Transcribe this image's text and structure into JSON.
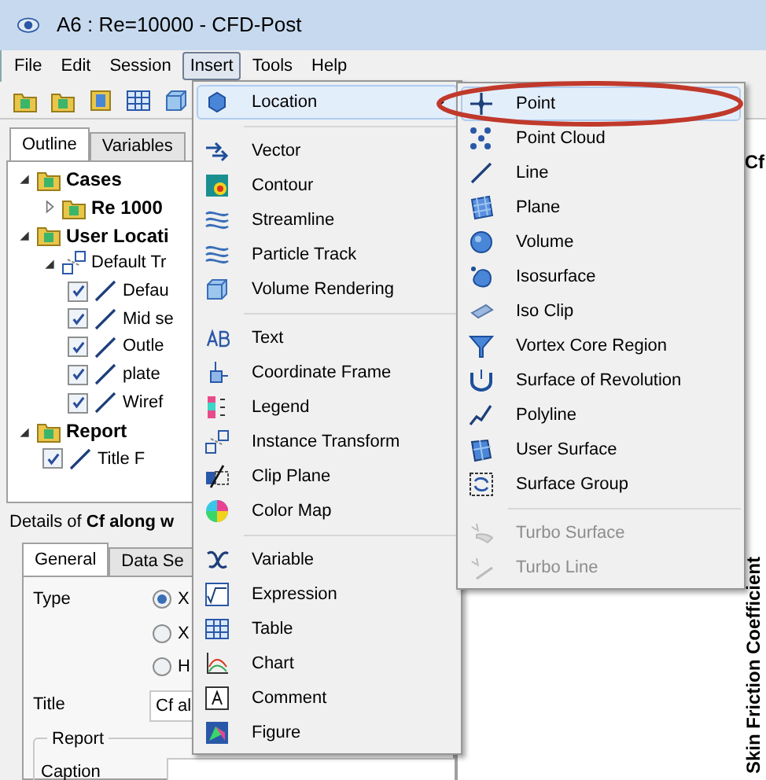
{
  "window": {
    "title": "A6 : Re=10000 - CFD-Post"
  },
  "menubar": [
    {
      "label": "File",
      "selected": false
    },
    {
      "label": "Edit",
      "selected": false
    },
    {
      "label": "Session",
      "selected": false
    },
    {
      "label": "Insert",
      "selected": true
    },
    {
      "label": "Tools",
      "selected": false
    },
    {
      "label": "Help",
      "selected": false
    }
  ],
  "outline": {
    "tabs": [
      {
        "label": "Outline",
        "selected": true
      },
      {
        "label": "Variables",
        "selected": false
      }
    ],
    "tree": [
      {
        "label": "Cases",
        "kind": "group",
        "expanded": true,
        "children": [
          {
            "label": "Re 1000",
            "kind": "group",
            "expanded": false
          }
        ]
      },
      {
        "label": "User Locati",
        "kind": "group",
        "expanded": true,
        "children": [
          {
            "label": "Default Tr",
            "kind": "folder",
            "expanded": true,
            "children": [
              {
                "label": "Defau",
                "kind": "item",
                "checked": true
              },
              {
                "label": "Mid se",
                "kind": "item",
                "checked": true
              },
              {
                "label": "Outle",
                "kind": "item",
                "checked": true
              },
              {
                "label": "plate",
                "kind": "item",
                "checked": true
              },
              {
                "label": "Wiref",
                "kind": "item",
                "checked": true
              }
            ]
          }
        ]
      },
      {
        "label": "Report",
        "kind": "group",
        "expanded": true,
        "children": [
          {
            "label": "Title F",
            "kind": "item",
            "checked": true
          }
        ]
      }
    ]
  },
  "details": {
    "title": "Details of **Cf along w**",
    "tabs": [
      {
        "label": "General",
        "selected": true
      },
      {
        "label": "Data Se",
        "selected": false
      }
    ],
    "type_label": "Type",
    "type_options": [
      {
        "label": "X",
        "selected": true
      },
      {
        "label": "X",
        "selected": false
      },
      {
        "label": "H",
        "selected": false
      }
    ],
    "title_label": "Title",
    "title_value": "Cf al",
    "group_label": "Report",
    "caption_label": "Caption"
  },
  "viewer": {
    "heading": "Cf",
    "axis_label": "Skin Friction Coefficient"
  },
  "insert_menu": {
    "groups": [
      [
        {
          "label": "Location",
          "submenu": true,
          "selected": true
        }
      ],
      [
        {
          "label": "Vector",
          "submenu": false,
          "selected": false
        },
        {
          "label": "Contour",
          "submenu": false,
          "selected": false
        },
        {
          "label": "Streamline",
          "submenu": false,
          "selected": false
        },
        {
          "label": "Particle Track",
          "submenu": false,
          "selected": false
        },
        {
          "label": "Volume Rendering",
          "submenu": false,
          "selected": false
        }
      ],
      [
        {
          "label": "Text",
          "submenu": false,
          "selected": false
        },
        {
          "label": "Coordinate Frame",
          "submenu": false,
          "selected": false
        },
        {
          "label": "Legend",
          "submenu": false,
          "selected": false
        },
        {
          "label": "Instance Transform",
          "submenu": false,
          "selected": false
        },
        {
          "label": "Clip Plane",
          "submenu": false,
          "selected": false
        },
        {
          "label": "Color Map",
          "submenu": false,
          "selected": false
        }
      ],
      [
        {
          "label": "Variable",
          "submenu": false,
          "selected": false
        },
        {
          "label": "Expression",
          "submenu": false,
          "selected": false
        },
        {
          "label": "Table",
          "submenu": false,
          "selected": false
        },
        {
          "label": "Chart",
          "submenu": false,
          "selected": false
        },
        {
          "label": "Comment",
          "submenu": false,
          "selected": false
        },
        {
          "label": "Figure",
          "submenu": false,
          "selected": false
        }
      ]
    ]
  },
  "location_submenu": {
    "groups": [
      [
        {
          "label": "Point",
          "selected": true,
          "disabled": false
        },
        {
          "label": "Point Cloud",
          "selected": false,
          "disabled": false
        },
        {
          "label": "Line",
          "selected": false,
          "disabled": false
        },
        {
          "label": "Plane",
          "selected": false,
          "disabled": false
        },
        {
          "label": "Volume",
          "selected": false,
          "disabled": false
        },
        {
          "label": "Isosurface",
          "selected": false,
          "disabled": false
        },
        {
          "label": "Iso Clip",
          "selected": false,
          "disabled": false
        },
        {
          "label": "Vortex Core Region",
          "selected": false,
          "disabled": false
        },
        {
          "label": "Surface of Revolution",
          "selected": false,
          "disabled": false
        },
        {
          "label": "Polyline",
          "selected": false,
          "disabled": false
        },
        {
          "label": "User Surface",
          "selected": false,
          "disabled": false
        },
        {
          "label": "Surface Group",
          "selected": false,
          "disabled": false
        }
      ],
      [
        {
          "label": "Turbo Surface",
          "selected": false,
          "disabled": true
        },
        {
          "label": "Turbo Line",
          "selected": false,
          "disabled": true
        }
      ]
    ]
  }
}
